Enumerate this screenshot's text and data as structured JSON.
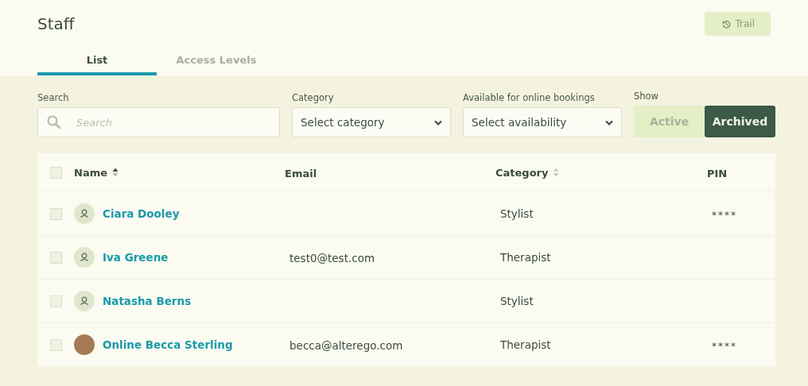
{
  "page": {
    "title": "Staff",
    "trail_button": "Trail"
  },
  "tabs": [
    {
      "label": "List",
      "selected": true
    },
    {
      "label": "Access Levels",
      "selected": false
    }
  ],
  "filters": {
    "search": {
      "label": "Search",
      "placeholder": "Search"
    },
    "category": {
      "label": "Category",
      "value": "Select category"
    },
    "availability": {
      "label": "Available for online bookings",
      "value": "Select availability"
    },
    "show": {
      "label": "Show",
      "options": [
        {
          "label": "Active",
          "selected": false
        },
        {
          "label": "Archived",
          "selected": true
        }
      ]
    }
  },
  "table": {
    "select_all_checked": false,
    "columns": [
      {
        "label": "Name",
        "sortable": true,
        "sorted_ascending": true
      },
      {
        "label": "Email",
        "sortable": false
      },
      {
        "label": "Category",
        "sortable": true,
        "sorted_ascending": false
      },
      {
        "label": "PIN",
        "sortable": false
      }
    ],
    "rows": [
      {
        "checked": false,
        "has_photo": false,
        "name": "Ciara Dooley",
        "email": "",
        "category": "Stylist",
        "pin": "****"
      },
      {
        "checked": false,
        "has_photo": false,
        "name": "Iva Greene",
        "email": "test0@test.com",
        "category": "Therapist",
        "pin": ""
      },
      {
        "checked": false,
        "has_photo": false,
        "name": "Natasha Berns",
        "email": "",
        "category": "Stylist",
        "pin": ""
      },
      {
        "checked": false,
        "has_photo": true,
        "name": "Online Becca Sterling",
        "email": "becca@alterego.com",
        "category": "Therapist",
        "pin": "****"
      }
    ]
  }
}
